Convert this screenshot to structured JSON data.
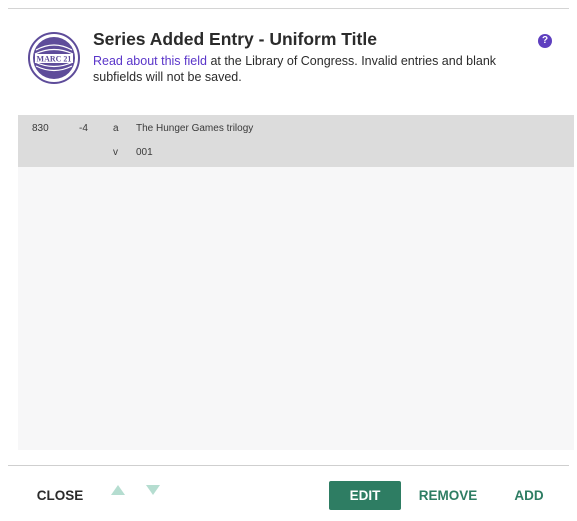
{
  "header": {
    "logo_text": "MARC 21",
    "title": "Series Added Entry - Uniform Title",
    "link_text": "Read about this field",
    "description_rest": " at the Library of Congress. Invalid entries and blank subfields will not be saved.",
    "help_glyph": "?"
  },
  "field": {
    "tag": "830",
    "indicators": "-4",
    "subfields": [
      {
        "code": "a",
        "value": "The Hunger Games trilogy"
      },
      {
        "code": "v",
        "value": "001"
      }
    ]
  },
  "footer": {
    "close_label": "CLOSE",
    "edit_label": "EDIT",
    "remove_label": "REMOVE",
    "add_label": "ADD"
  },
  "colors": {
    "accent": "#2e7d63",
    "link": "#5a35c9",
    "help": "#5e3fbf",
    "arrow_disabled": "#b5ddd0"
  },
  "icons": {
    "logo": "marc21-logo-icon",
    "help": "help-icon",
    "move_up": "arrow-up-icon",
    "move_down": "arrow-down-icon"
  }
}
